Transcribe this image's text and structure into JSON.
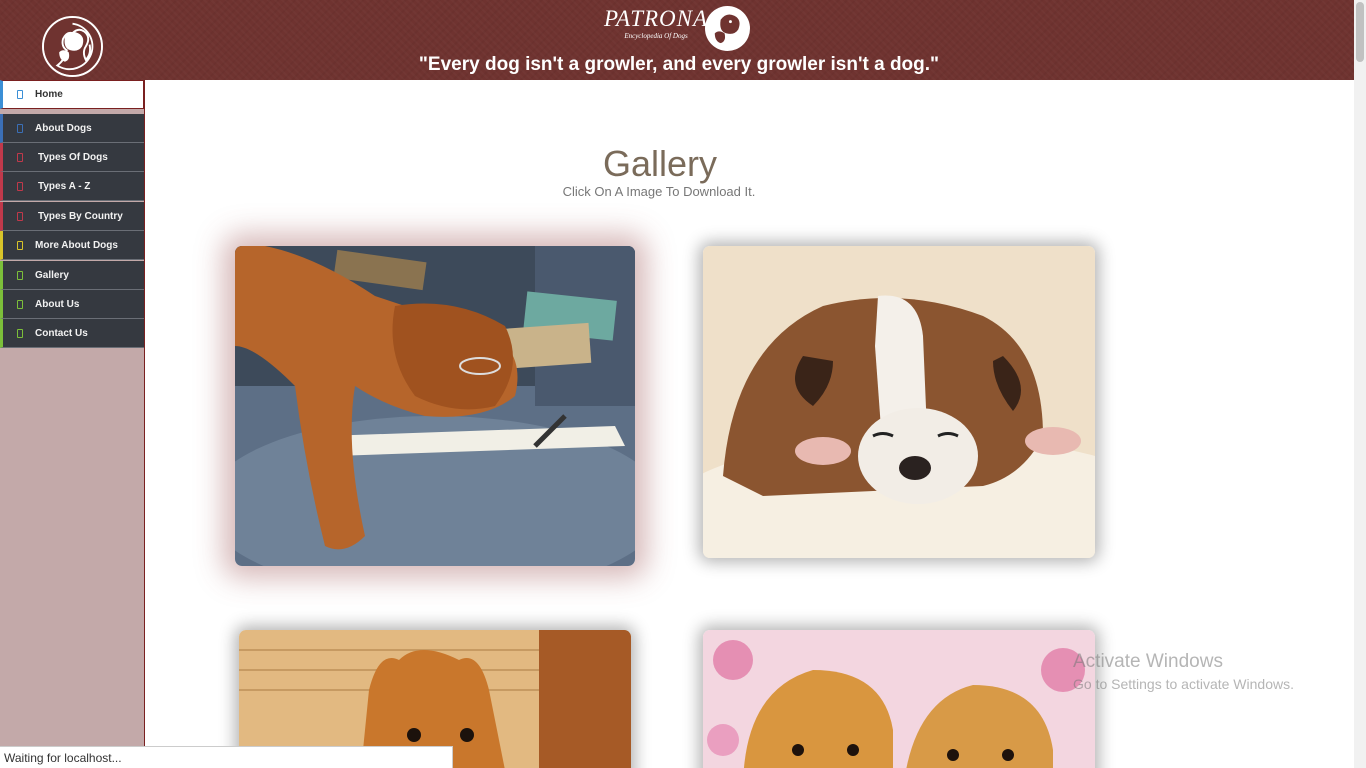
{
  "header": {
    "brand_title": "PATRONA",
    "brand_subtitle": "Encyclopedia Of Dogs",
    "quote": "\"Every dog isn't a growler, and every growler isn't a dog.\""
  },
  "sidebar": {
    "items": [
      {
        "label": "Home",
        "accent": "#3b8fd6",
        "active": true
      },
      {
        "label": "About Dogs",
        "accent": "#3b6fb6"
      },
      {
        "label": "Types Of Dogs",
        "accent": "#c0394b"
      },
      {
        "label": "Types A - Z",
        "accent": "#c0394b"
      },
      {
        "label": "Types By Country",
        "accent": "#c0394b"
      },
      {
        "label": "More About Dogs",
        "accent": "#d8c42a"
      },
      {
        "label": "Gallery",
        "accent": "#7cbf3a"
      },
      {
        "label": "About Us",
        "accent": "#7cbf3a"
      },
      {
        "label": "Contact Us",
        "accent": "#7cbf3a"
      }
    ]
  },
  "main": {
    "title": "Gallery",
    "subtitle": "Click On A Image To Download It."
  },
  "watermark": {
    "title": "Activate Windows",
    "subtitle": "Go to Settings to activate Windows."
  },
  "status_bar": {
    "text": "Waiting for localhost..."
  },
  "colors": {
    "header_bg": "#6f3330",
    "sidebar_bg": "#c3a9a9",
    "nav_bg": "#353940"
  }
}
